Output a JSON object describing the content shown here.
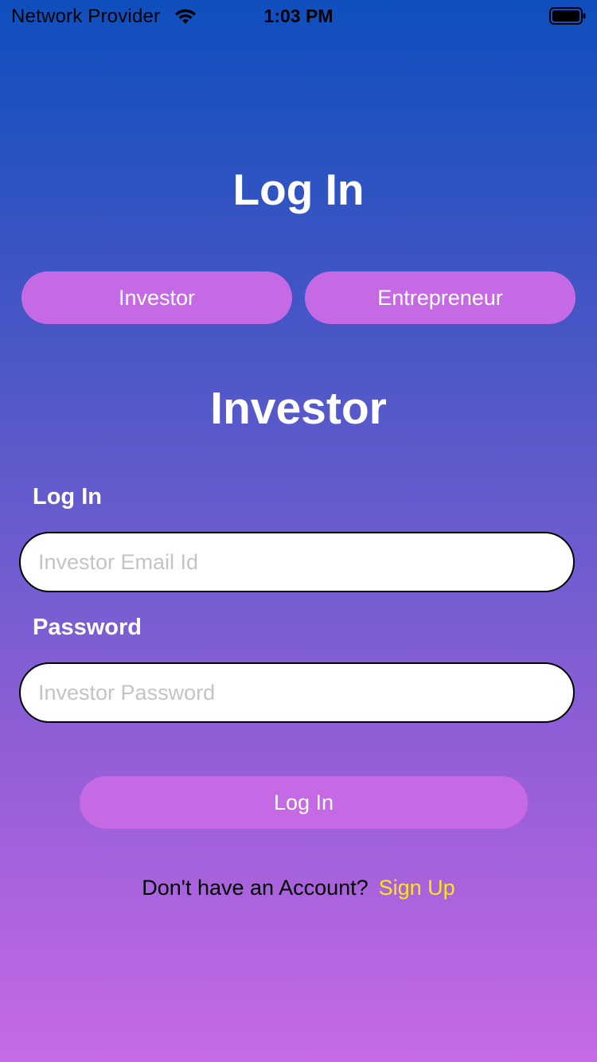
{
  "status_bar": {
    "carrier": "Network Provider",
    "time": "1:03 PM",
    "wifi_icon": "wifi-icon",
    "battery_icon": "battery-icon"
  },
  "page_title": "Log In",
  "role_tabs": [
    {
      "label": "Investor"
    },
    {
      "label": "Entrepreneur"
    }
  ],
  "section_title": "Investor",
  "form": {
    "email_label": "Log In",
    "email_value": "",
    "email_placeholder": "Investor Email Id",
    "password_label": "Password",
    "password_value": "",
    "password_placeholder": "Investor Password",
    "submit_label": "Log In"
  },
  "signup": {
    "prompt": "Don't have an Account?",
    "link_label": "Sign Up"
  },
  "colors": {
    "gradient_top": "#0e4fbd",
    "gradient_bottom": "#c56ae4",
    "button_bg": "#c56ae4",
    "link": "#ffe41a",
    "text_light": "#ffffff"
  }
}
